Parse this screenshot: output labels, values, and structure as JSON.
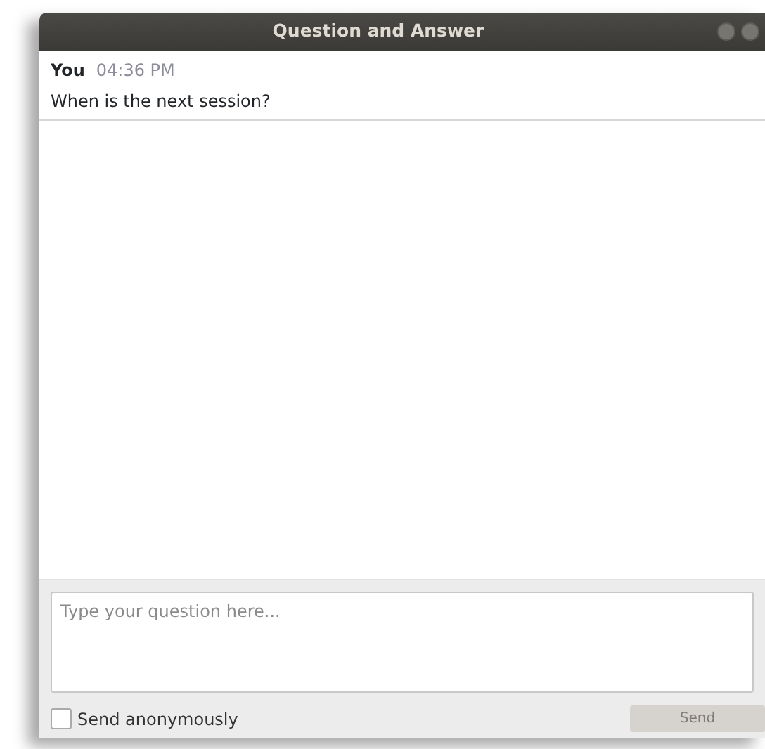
{
  "window": {
    "title": "Question and Answer"
  },
  "messages": [
    {
      "author": "You",
      "time": "04:36 PM",
      "text": "When is the next session?"
    }
  ],
  "question_field": {
    "placeholder": "Type your question here..."
  },
  "anonymous": {
    "label": "Send anonymously",
    "checked": false
  },
  "send_button": {
    "label": "Send",
    "disabled": true
  }
}
